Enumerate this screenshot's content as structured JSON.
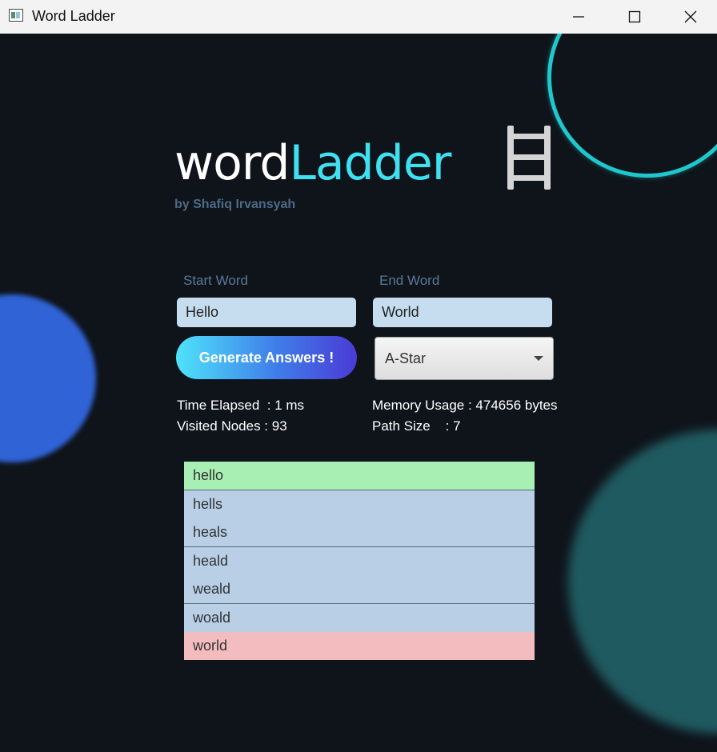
{
  "window": {
    "title": "Word Ladder"
  },
  "logo": {
    "part1": "word",
    "part2": "Ladder",
    "byline": "by Shafiq Irvansyah"
  },
  "form": {
    "start_label": "Start Word",
    "start_value": "Hello",
    "end_label": "End Word",
    "end_value": "World",
    "generate_label": "Generate Answers !",
    "algorithm_selected": "A-Star"
  },
  "stats": {
    "time_elapsed": "Time Elapsed  : 1 ms",
    "visited_nodes": "Visited Nodes : 93",
    "memory_usage": "Memory Usage : 474656 bytes",
    "path_size": "Path Size    : 7"
  },
  "results": [
    "hello",
    "hells",
    "heals",
    "heald",
    "weald",
    "woald",
    "world"
  ],
  "colors": {
    "background": "#0f141b",
    "accent": "#3fe0f0",
    "field_bg": "#c5ddef",
    "start_row": "#a7efb3",
    "end_row": "#f3bdbf",
    "list_bg": "#b8cfe6"
  },
  "icons": {
    "app": "window-app-icon",
    "minimize": "minimize-icon",
    "maximize": "maximize-icon",
    "close": "close-icon",
    "ladder": "ladder-icon",
    "dropdown": "chevron-down-icon"
  }
}
